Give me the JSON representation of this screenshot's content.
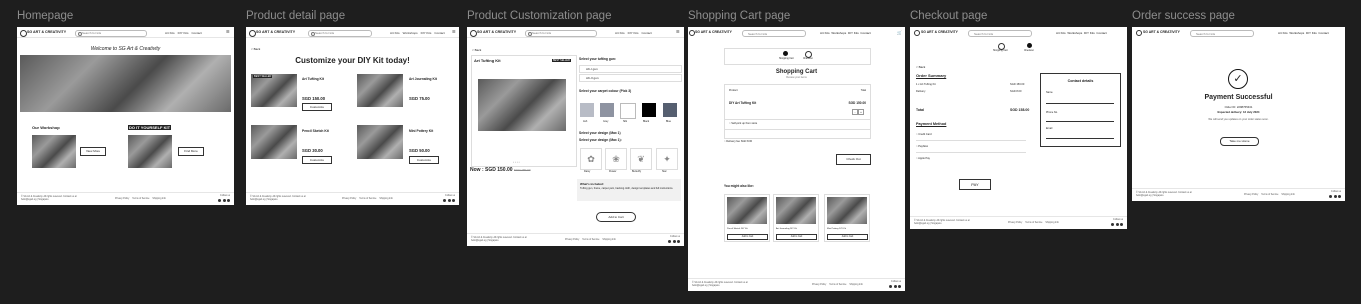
{
  "frame_labels": [
    "Homepage",
    "Product detail page",
    "Product Customization page",
    "Shopping Cart page",
    "Checkout page",
    "Order success page"
  ],
  "nav": {
    "brand": "SG ART & CREATIVITY",
    "search_placeholder": "Search for kits",
    "links": [
      "Art Kits",
      "Workshops",
      "DIY Kits",
      "About",
      "Contact"
    ]
  },
  "footer": {
    "left": "© SG Art & Creativity. All rights reserved. Contact us at hello@sgart.sg | Singapore",
    "mid": [
      "Privacy Policy",
      "Terms of Service",
      "Shipping Info"
    ],
    "right": "Follow us"
  },
  "home": {
    "welcome": "Welcome to SG Art & Creativity",
    "workshop_title": "Our Workshop",
    "workshop_btn": "View More",
    "diy_title": "DO IT YOURSELF KIT",
    "diy_btn": "Find More"
  },
  "product": {
    "back": "< Back",
    "title": "Customize your DIY Kit today!",
    "badge": "BEST SELLER",
    "items": [
      {
        "name": "Art Tufting Kit",
        "price": "SGD 150.00",
        "btn": "Customize"
      },
      {
        "name": "Art Journaling Kit",
        "price": "SGD 75.00",
        "btn": "Customize"
      },
      {
        "name": "Pencil Sketch Kit",
        "price": "SGD 30.00",
        "btn": "Customize"
      },
      {
        "name": "Mini Pottery Kit",
        "price": "SGD 50.00",
        "btn": "Customize"
      }
    ]
  },
  "custom": {
    "back": "< Back",
    "name": "Art Tufting Kit",
    "badge": "BEST SELLER",
    "tufting_q": "Select your tufting gun:",
    "gun_options": [
      "AK-I gun",
      "AK-II gun"
    ],
    "color_q": "Select your carpet colour (Pick 3)",
    "colors": [
      "Ash",
      "Grey",
      "Silk",
      "Black",
      "Blue"
    ],
    "design_q1": "Select your design (Max 1)",
    "design_q2": "Select your design (Max 1):",
    "designs": [
      "Daisy",
      "Flower",
      "Butterfly",
      "Star"
    ],
    "price": "Now : SGD 150.00",
    "old_price": "SGD 180.00",
    "included_title": "What's included:",
    "included": "Tufting gun, frame, carpet yarn, backing cloth, design templates and full instructions.",
    "add_btn": "Add to Cart"
  },
  "cart": {
    "steps": [
      "Shopping Cart",
      "Checkout"
    ],
    "title": "Shopping Cart",
    "sub": "Review your items",
    "col_product": "Product",
    "col_total": "Total",
    "item": "DIY Art Tufting Kit",
    "item_price": "SGD 150.00",
    "qty": "1",
    "pickup": "Self-pick up from store",
    "delivery": "Delivery fee",
    "delivery_fee": "SGD 8.00",
    "checkout_btn": "Check Out",
    "recommend": "You might also like:",
    "recs": [
      "Pencil Sketch DIY Kit",
      "Art Journaling DIY Kit",
      "Mini Pottery DIY Kit"
    ],
    "rec_btn": "Add to Cart"
  },
  "checkout": {
    "steps": [
      "Shopping Cart",
      "Checkout"
    ],
    "back": "< Back",
    "summary": "Order Summary",
    "lines": [
      "1 x Art Tufting Kit",
      "Delivery",
      "Total"
    ],
    "amounts": [
      "SGD 150.00",
      "SGD 8.00",
      "SGD 158.00"
    ],
    "contact": "Contact details",
    "fields": [
      "Name",
      "Phone No.",
      "Email"
    ],
    "payment": "Payment Method",
    "methods": [
      "Credit Card",
      "PayNow",
      "Apple Pay"
    ],
    "pay_btn": "PAY"
  },
  "success": {
    "title": "Payment Successful",
    "order": "Order ID: 2298765431",
    "delivery": "Expected delivery: 12 July 2024",
    "note": "We will send you updates on your order status soon.",
    "btn": "Take me Home"
  }
}
